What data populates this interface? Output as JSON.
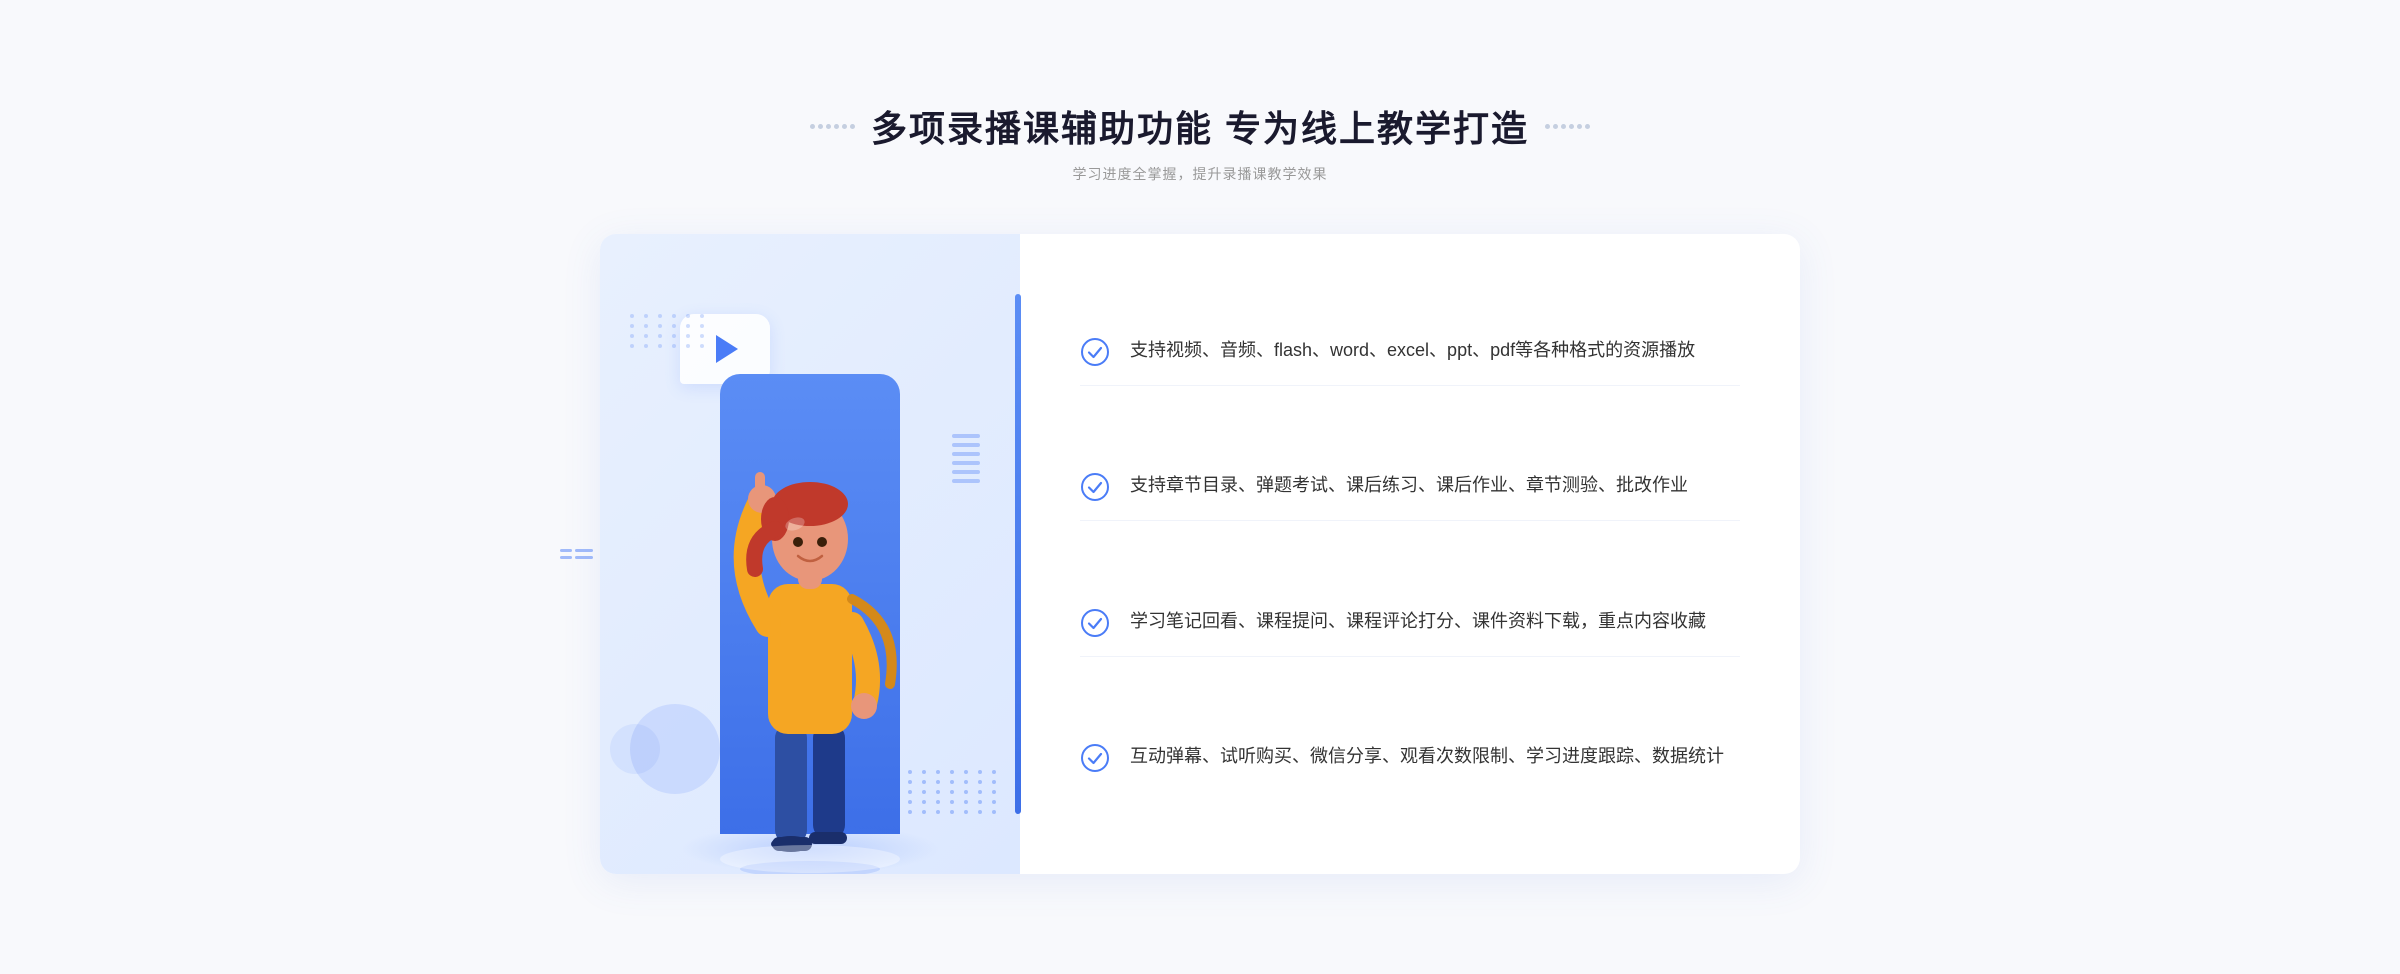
{
  "header": {
    "title": "多项录播课辅助功能 专为线上教学打造",
    "subtitle": "学习进度全掌握，提升录播课教学效果"
  },
  "features": [
    {
      "id": 1,
      "text": "支持视频、音频、flash、word、excel、ppt、pdf等各种格式的资源播放"
    },
    {
      "id": 2,
      "text": "支持章节目录、弹题考试、课后练习、课后作业、章节测验、批改作业"
    },
    {
      "id": 3,
      "text": "学习笔记回看、课程提问、课程评论打分、课件资料下载，重点内容收藏"
    },
    {
      "id": 4,
      "text": "互动弹幕、试听购买、微信分享、观看次数限制、学习进度跟踪、数据统计"
    }
  ],
  "colors": {
    "accent": "#4a7cf7",
    "accent_dark": "#3d6fe8",
    "title": "#1a1a2e",
    "text": "#333333",
    "subtitle": "#999999"
  }
}
